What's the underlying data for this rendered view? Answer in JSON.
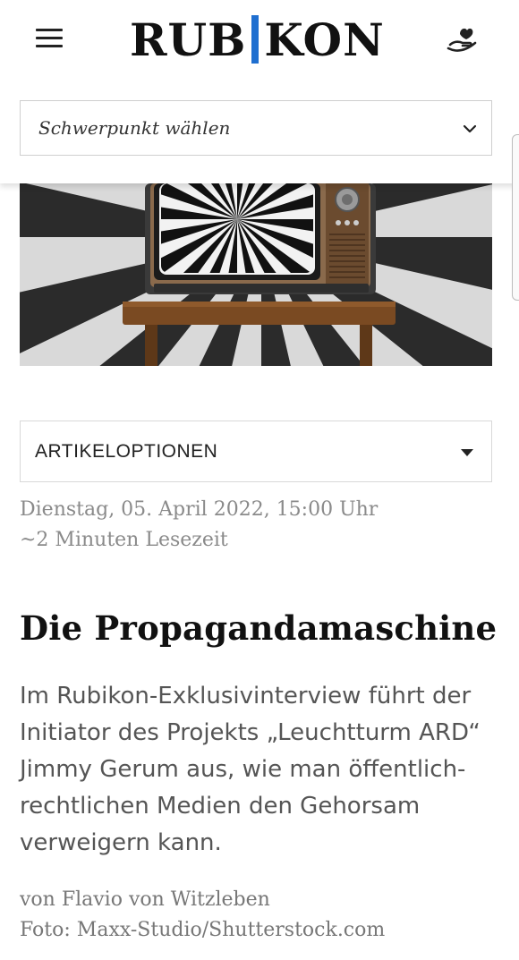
{
  "header": {
    "logo_left": "RUB",
    "logo_right": "KON",
    "menu_icon": "hamburger-menu-icon",
    "support_icon": "hand-support-icon",
    "accent_color": "#1f6fd0"
  },
  "topic_select": {
    "label": "Schwerpunkt wählen",
    "icon": "chevron-down-icon"
  },
  "article": {
    "hero_image": "retro-tv-hypnotic-spiral",
    "options_label": "ARTIKELOPTIONEN",
    "date": "Dienstag, 05. April 2022, 15:00 Uhr",
    "read_time": "~2 Minuten Lesezeit",
    "title": "Die Propagandamaschine",
    "lead": "Im Rubikon-Exklusivinterview führt der Initiator des Projekts „Leuchtturm ARD“ Jimmy Gerum aus, wie man öffentlich-rechtlichen Medien den Gehorsam verweigern kann.",
    "author": "von Flavio von Witzleben",
    "photo_credit": "Foto: Maxx-Studio/Shutterstock.com"
  }
}
